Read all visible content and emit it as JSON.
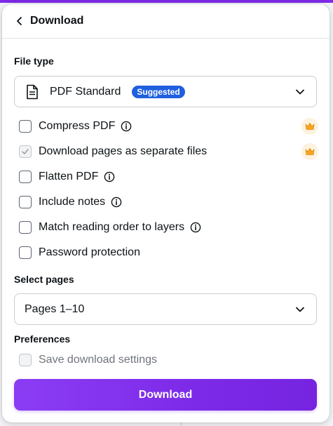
{
  "header": {
    "back_icon": "chevron-left-icon",
    "title": "Download"
  },
  "file_type": {
    "label": "File type",
    "icon": "document-icon",
    "selected": "PDF Standard",
    "badge": "Suggested",
    "badge_color": "#1f5fe0"
  },
  "options": [
    {
      "label": "Compress PDF",
      "checked": false,
      "info_icon": true,
      "premium": true
    },
    {
      "label": "Download pages as separate files",
      "checked": true,
      "info_icon": false,
      "premium": true
    },
    {
      "label": "Flatten PDF",
      "checked": false,
      "info_icon": true,
      "premium": false
    },
    {
      "label": "Include notes",
      "checked": false,
      "info_icon": true,
      "premium": false
    },
    {
      "label": "Match reading order to layers",
      "checked": false,
      "info_icon": true,
      "premium": false
    },
    {
      "label": "Password protection",
      "checked": false,
      "info_icon": false,
      "premium": false
    }
  ],
  "select_pages": {
    "label": "Select pages",
    "selected": "Pages 1–10"
  },
  "preferences": {
    "label": "Preferences",
    "save_settings_label": "Save download settings",
    "save_settings_checked": false,
    "save_settings_disabled": true
  },
  "download_button": {
    "label": "Download",
    "color": "#7d2ae8"
  },
  "premium_icon": "crown-icon",
  "premium_color": "#f5a623"
}
